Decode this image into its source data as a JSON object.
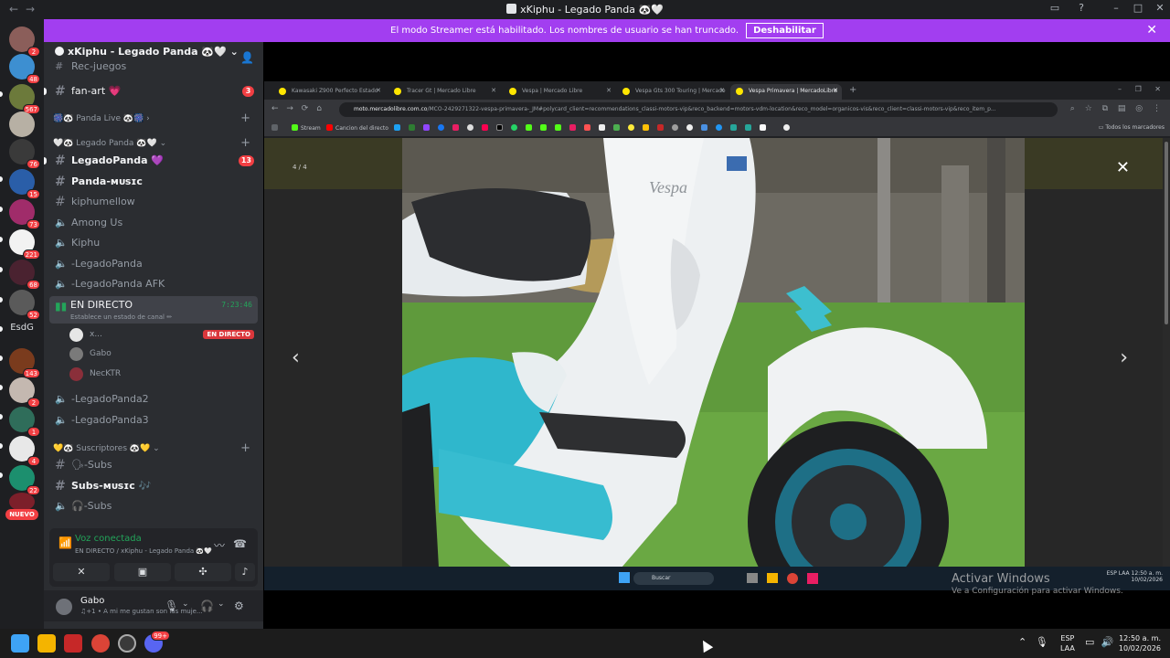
{
  "window": {
    "title": "xKiphu - Legado Panda 🐼🤍"
  },
  "banner": {
    "text": "El modo Streamer está habilitado. Los nombres de usuario se han truncado.",
    "button": "Deshabilitar"
  },
  "rail": {
    "badges": [
      "2",
      "48",
      "567",
      "76",
      "15",
      "73",
      "221",
      "68",
      "52",
      "143",
      "2",
      "1",
      "4",
      "22"
    ],
    "esdg": "EsdG",
    "nuevo": "NUEVO"
  },
  "sidebar": {
    "guild_name": "xKiphu - Legado Panda 🐼🤍",
    "partial_channel": "Rec-juegos",
    "channels": {
      "fanart": {
        "label": "fan-art 💗",
        "badge": "3"
      },
      "cat_panda_live": "🎆🐼 Panda Live 🐼🎆",
      "cat_legado": "🤍🐼 Legado Panda 🐼🤍",
      "legadopanda": {
        "label": "LegadoPanda 💜",
        "badge": "13"
      },
      "panda_music": "Panda-ᴍᴜsɪᴄ",
      "kiphumellow": "kiphumellow",
      "among_us": "Among Us",
      "kiphu": "Kiphu",
      "legado_voice": "-LegadoPanda",
      "legado_afk": "-LegadoPanda AFK",
      "live": {
        "name": "EN DIRECTO",
        "time": "7:23:46",
        "status": "Establece un estado de canal ✏"
      },
      "voice_users": [
        {
          "name": "x...",
          "live": "EN DIRECTO"
        },
        {
          "name": "Gabo"
        },
        {
          "name": "NecKTR"
        }
      ],
      "legado2": "-LegadoPanda2",
      "legado3": "-LegadoPanda3",
      "cat_subs": "💛🐼 Suscriptores 🐼💛",
      "subs_text": "🗣-Subs",
      "subs_music": "Subs-ᴍᴜsɪᴄ 🎶",
      "subs_voice": "🎧-Subs"
    },
    "voice_panel": {
      "status": "Voz conectada",
      "location": "EN DIRECTO / xKiphu - Legado Panda 🐼🤍"
    },
    "user": {
      "name": "Gabo",
      "status": "♫+1 • A mi me gustan son las muje..."
    }
  },
  "browser": {
    "tabs": [
      "Kawasaki Z900 Perfecto Estado",
      "Tracer Gt | Mercado Libre",
      "Vespa | Mercado Libre",
      "Vespa Gts 300 Touring | Mercado",
      "Vespa Primavera | MercadoLibre"
    ],
    "url_host": "moto.mercadolibre.com.co",
    "url_path": "/MCO-2429271322-vespa-primavera-_JM#polycard_client=recommendations_classi-motors-vip&reco_backend=motors-vdm-location&reco_model=organicos-vis&reco_client=classi-motors-vip&reco_item_p...",
    "bookmarks": [
      "Stream",
      "Cancion del directo"
    ],
    "all_bookmarks": "Todos los marcadores",
    "counter": "4 / 4",
    "taskbar_search": "Buscar",
    "tray_lang": "ESP LAA",
    "tray_time": "12:50 a. m.",
    "tray_date": "10/02/2026"
  },
  "watermark": {
    "title": "Activar Windows",
    "subtitle": "Ve a Configuración para activar Windows."
  },
  "taskbar": {
    "lang_top": "ESP",
    "lang_bottom": "LAA",
    "time": "12:50 a. m.",
    "date": "10/02/2026",
    "discord_badge": "99+"
  }
}
